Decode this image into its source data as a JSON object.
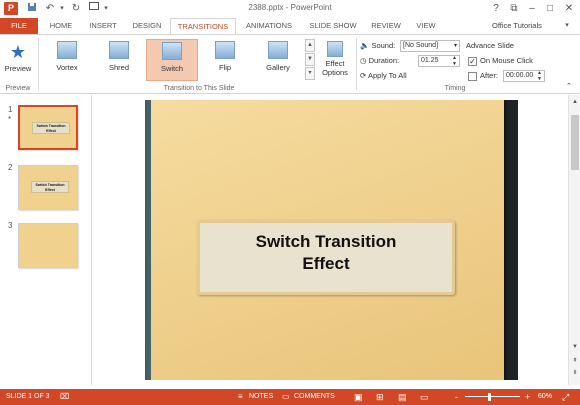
{
  "app": {
    "logo": "P",
    "title": "2388.pptx - PowerPoint"
  },
  "qat": {
    "save_icon": "save-icon",
    "undo_icon": "undo-icon",
    "redo_icon": "redo-icon",
    "customize_icon": "customize-icon"
  },
  "window": {
    "help": "?",
    "restore": "⧉",
    "minimize": "–",
    "maximize": "□",
    "close": "✕"
  },
  "tabs": {
    "file": "FILE",
    "home": "HOME",
    "insert": "INSERT",
    "design": "DESIGN",
    "transitions": "TRANSITIONS",
    "animations": "ANIMATIONS",
    "slideshow": "SLIDE SHOW",
    "review": "REVIEW",
    "view": "VIEW"
  },
  "account": "Office Tutorials",
  "ribbon": {
    "preview": {
      "label": "Preview",
      "group": "Preview"
    },
    "transitions": [
      {
        "label": "Vortex"
      },
      {
        "label": "Shred"
      },
      {
        "label": "Switch"
      },
      {
        "label": "Flip"
      },
      {
        "label": "Gallery"
      }
    ],
    "transition_group": "Transition to This Slide",
    "effect_options": {
      "line1": "Effect",
      "line2": "Options"
    },
    "timing": {
      "sound_label": "Sound:",
      "sound_value": "[No Sound]",
      "duration_label": "Duration:",
      "duration_value": "01.25",
      "apply_all": "Apply To All",
      "advance_label": "Advance Slide",
      "on_mouse_click": "On Mouse Click",
      "on_mouse_checked": true,
      "after_label": "After:",
      "after_value": "00:00.00",
      "group": "Timing"
    }
  },
  "thumbnails": [
    {
      "number": "1",
      "star": "*",
      "line1": "Switch Transition",
      "line2": "Effect",
      "selected": true
    },
    {
      "number": "2",
      "line1": "Switch Transition",
      "line2": "Effect",
      "selected": false
    },
    {
      "number": "3",
      "line1": "",
      "line2": "",
      "selected": false
    }
  ],
  "slide": {
    "title_line1": "Switch Transition",
    "title_line2": "Effect"
  },
  "status": {
    "slide_info": "SLIDE 1 OF 3",
    "notes": "NOTES",
    "comments": "COMMENTS",
    "zoom_minus": "-",
    "zoom_plus": "+",
    "zoom": "60%"
  },
  "colors": {
    "accent": "#d24726",
    "slide_paper": "#eccb85"
  }
}
